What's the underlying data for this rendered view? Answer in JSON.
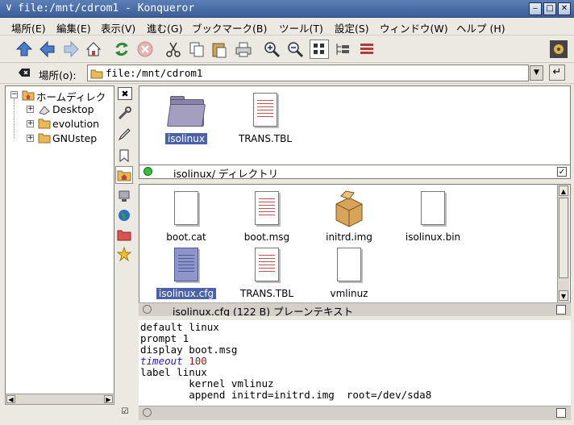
{
  "window": {
    "title": "file:/mnt/cdrom1 - Konqueror"
  },
  "menu": [
    "場所(E)",
    "編集(E)",
    "表示(V)",
    "進む(G)",
    "ブックマーク(B)",
    "ツール(T)",
    "設定(S)",
    "ウィンドウ(W)",
    "ヘルプ (H)"
  ],
  "location": {
    "label": "場所(o):",
    "value": "file:/mnt/cdrom1"
  },
  "tree": {
    "root": "ホームディレク",
    "children": [
      "Desktop",
      "evolution",
      "GNUstep"
    ]
  },
  "top_pane": {
    "items": [
      {
        "name": "isolinux",
        "type": "folder",
        "selected": true
      },
      {
        "name": "TRANS.TBL",
        "type": "text",
        "selected": false
      }
    ],
    "status": "isolinux/  ディレクトリ"
  },
  "middle_pane": {
    "items": [
      {
        "name": "boot.cat",
        "type": "blank"
      },
      {
        "name": "boot.msg",
        "type": "text"
      },
      {
        "name": "initrd.img",
        "type": "package"
      },
      {
        "name": "isolinux.bin",
        "type": "blank"
      },
      {
        "name": "isolinux.cfg",
        "type": "config",
        "selected": true
      },
      {
        "name": "TRANS.TBL",
        "type": "text"
      },
      {
        "name": "vmlinuz",
        "type": "blank"
      }
    ],
    "status": "isolinux.cfg (122 B)  プレーンテキスト"
  },
  "text_view": {
    "lines": [
      {
        "text": "default linux"
      },
      {
        "text": "prompt 1"
      },
      {
        "text": "display boot.msg"
      },
      {
        "keyword": "timeout",
        "value": "100"
      },
      {
        "text": "label linux"
      },
      {
        "text": "        kernel vmlinuz"
      },
      {
        "text": "        append initrd=initrd.img  root=/dev/sda8"
      }
    ]
  },
  "colors": {
    "selection": "#4a63a8",
    "titlebar": "#4a6ca8",
    "keyword": "#2418b8",
    "number": "#8a1a1a"
  }
}
